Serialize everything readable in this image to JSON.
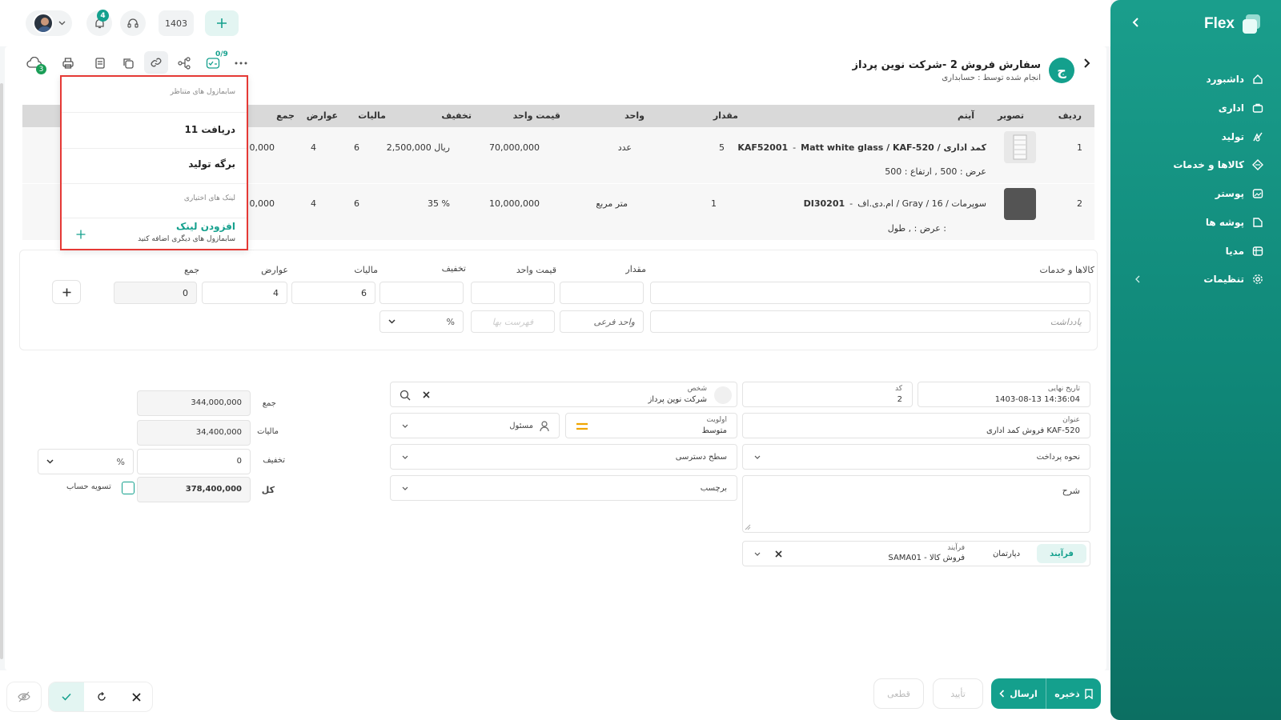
{
  "app": {
    "brand": "Flex"
  },
  "sidebar": {
    "items": [
      {
        "label": "داشبورد",
        "icon": "home-icon"
      },
      {
        "label": "اداری",
        "icon": "briefcase-icon"
      },
      {
        "label": "تولید",
        "icon": "factory-icon"
      },
      {
        "label": "کالاها و خدمات",
        "icon": "box-icon"
      },
      {
        "label": "پوستر",
        "icon": "image-icon"
      },
      {
        "label": "پوشه ها",
        "icon": "folder-icon"
      },
      {
        "label": "مدیا",
        "icon": "media-icon"
      },
      {
        "label": "تنظیمات",
        "icon": "settings-icon"
      }
    ]
  },
  "topbar": {
    "year": "1403",
    "notification_count": "4"
  },
  "document": {
    "title": "سفارش فروش 2 -شرکت نوین پرداز",
    "subtitle": "انجام شده توسط : حسابداری",
    "avatar_letter": "ج",
    "step_counter": "0/9",
    "cloud_count": "3"
  },
  "dropdown": {
    "section_related": "سابمازول های متناظر",
    "item_receipt": "دریافت 11",
    "item_production": "برگه تولید",
    "section_optional": "لینک های اختیاری",
    "add_link": "افزودن لینک",
    "add_link_sub": "سابمازول های دیگری اضافه کنید"
  },
  "table": {
    "headers": {
      "row": "ردیف",
      "image": "تصویر",
      "item": "آیتم",
      "qty": "مقدار",
      "unit": "واحد",
      "unit_price": "قیمت واحد",
      "discount": "تخفیف",
      "tax": "مالیات",
      "duties": "عوارض",
      "total": "جمع"
    },
    "rows": [
      {
        "row": "1",
        "code": "KAF52001",
        "name": "Matt white glass / KAF-520 / کمد اداری",
        "dims": "عرض : 500 ,  ارتفاع : 500",
        "qty": "5",
        "unit": "عدد",
        "unit_price": "70,000,000",
        "discount": "2,500,000 ریال",
        "tax": "6",
        "duties": "4",
        "total": "0,000"
      },
      {
        "row": "2",
        "code": "DI30201",
        "name": "ام.دی.اف / Gray / 16 / سوپرمات",
        "dims": "عرض : ,  طول :",
        "qty": "1",
        "unit": "متر مربع",
        "unit_price": "10,000,000",
        "discount": "35 %",
        "tax": "6",
        "duties": "4",
        "total": "0,000"
      }
    ]
  },
  "entry": {
    "goods_label": "کالاها و خدمات",
    "qty_label": "مقدار",
    "unit_price_label": "قیمت واحد",
    "discount_label": "تخفیف",
    "tax_label": "مالیات",
    "duties_label": "عوارض",
    "total_label": "جمع",
    "tax_value": "6",
    "duties_value": "4",
    "total_value": "0",
    "note_placeholder": "یادداشت",
    "sub_unit_placeholder": "واحد فرعی",
    "price_list_placeholder": "فهرست بها",
    "percent": "%"
  },
  "form": {
    "due_date_label": "تاریخ نهایی",
    "due_date_value": "1403-08-13 14:36:04",
    "code_label": "کد",
    "code_value": "2",
    "person_label": "شخص",
    "person_value": "شرکت نوین پرداز",
    "title_label": "عنوان",
    "title_value": "فروش کمد اداری KAF-520",
    "priority_label": "اولویت",
    "priority_value": "متوسط",
    "responsible": "مسئول",
    "payment_method": "نحوه پرداخت",
    "access_level": "سطح دسترسی",
    "tag": "برچسب",
    "description": "شرح",
    "process_tab": "فرآیند",
    "department_tab": "دپارتمان",
    "process_label": "فرآیند",
    "process_value": "SAMA01 - فروش کالا"
  },
  "summary": {
    "sum_label": "جمع",
    "sum_value": "344,000,000",
    "tax_label": "مالیات",
    "tax_value": "34,400,000",
    "discount_label": "تخفیف",
    "discount_value": "0",
    "percent": "%",
    "total_label": "کل",
    "total_value": "378,400,000",
    "settle_label": "تسویه حساب"
  },
  "footer": {
    "save": "ذخیره",
    "send": "ارسال",
    "approve": "تأیید",
    "final": "قطعی"
  },
  "colors": {
    "accent": "#14a08d",
    "highlight": "#e53935"
  }
}
